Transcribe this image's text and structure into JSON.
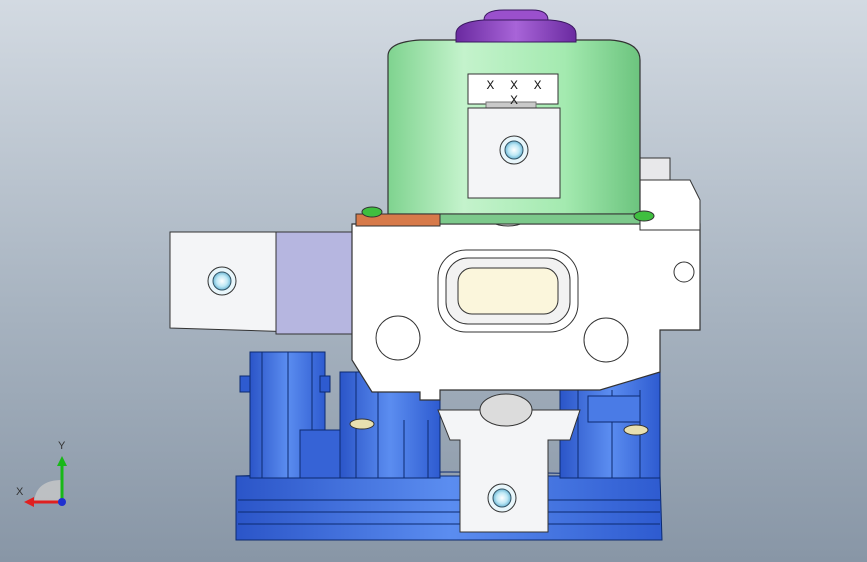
{
  "viewport": {
    "background_top": "#d3dae2",
    "background_bottom": "#8896a6"
  },
  "model": {
    "motor_marking": "X X X X",
    "colors": {
      "motor": "#a9ecb4",
      "motor_cap": "#8a3fbf",
      "valve_body": "#3c6fe0",
      "housing": "#ffffff",
      "bracket": "#f4f5f7",
      "bracket_shadow": "#b6b6e0",
      "port": "#9edff0"
    }
  },
  "triad": {
    "x_label": "X",
    "y_label": "Y",
    "x_color": "#e02020",
    "y_color": "#18b818",
    "z_color": "#2030d0",
    "icon": "axis-triad-icon"
  }
}
